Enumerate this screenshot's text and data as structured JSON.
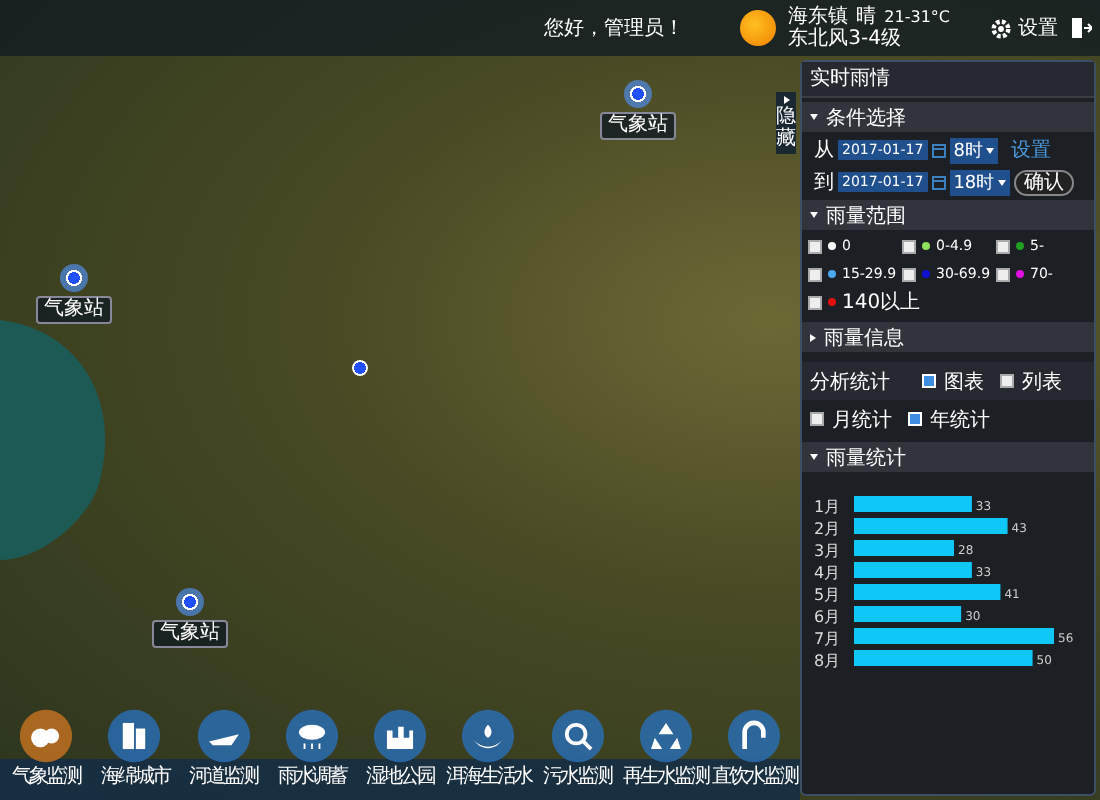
{
  "header": {
    "greeting": "您好，管理员！",
    "weather": {
      "location": "海东镇",
      "condition": "晴",
      "temperature": "21-31°C",
      "wind": "东北风3-4级"
    },
    "settings": "设置"
  },
  "map": {
    "markers": [
      {
        "label": "气象站"
      },
      {
        "label": "气象站"
      },
      {
        "label": "气象站"
      }
    ],
    "hide_tab": "隐藏"
  },
  "panel": {
    "title": "实时雨情",
    "condition": {
      "title": "条件选择",
      "expanded": true,
      "rows": [
        {
          "label": "从",
          "date": "2017-01-17",
          "hour": "8时",
          "action": "设置",
          "kind": "link"
        },
        {
          "label": "到",
          "date": "2017-01-17",
          "hour": "18时",
          "action": "确认",
          "kind": "button"
        }
      ]
    },
    "range": {
      "title": "雨量范围",
      "expanded": true,
      "items": [
        {
          "label": "0",
          "color": "#ffffff",
          "checked": false
        },
        {
          "label": "0-4.9",
          "color": "#8fe05a",
          "checked": false
        },
        {
          "label": "5-",
          "color": "#1f9e1f",
          "checked": false
        },
        {
          "label": "15-29.9",
          "color": "#4aa8f0",
          "checked": false
        },
        {
          "label": "30-69.9",
          "color": "#1010d0",
          "checked": false
        },
        {
          "label": "70-",
          "color": "#e010e0",
          "checked": false
        },
        {
          "label": "140以上",
          "color": "#e01010",
          "checked": false
        }
      ]
    },
    "info": {
      "title": "雨量信息",
      "expanded": false
    },
    "analysis": {
      "title": "分析统计",
      "options": [
        {
          "label": "图表",
          "checked": true
        },
        {
          "label": "列表",
          "checked": false
        }
      ],
      "periods": [
        {
          "label": "月统计",
          "checked": false
        },
        {
          "label": "年统计",
          "checked": true
        }
      ]
    },
    "stats": {
      "title": "雨量统计",
      "expanded": true,
      "chart_data": {
        "type": "bar",
        "orientation": "horizontal",
        "categories": [
          "1月",
          "2月",
          "3月",
          "4月",
          "5月",
          "6月",
          "7月",
          "8月"
        ],
        "series": [
          {
            "color": "#10c8f8",
            "values": [
              33,
              43,
              28,
              33,
              41,
              30,
              56,
              50
            ]
          }
        ],
        "data_labels": true
      }
    }
  },
  "toolbar": [
    {
      "label": "气象监测",
      "selected": true
    },
    {
      "label": "海绵城市",
      "selected": false
    },
    {
      "label": "河道监测",
      "selected": false
    },
    {
      "label": "雨水调蓄",
      "selected": false
    },
    {
      "label": "湿地公园",
      "selected": false
    },
    {
      "label": "洱海生活水",
      "selected": false
    },
    {
      "label": "污水监测",
      "selected": false
    },
    {
      "label": "再生水监测",
      "selected": false
    },
    {
      "label": "直饮水监测",
      "selected": false
    }
  ]
}
